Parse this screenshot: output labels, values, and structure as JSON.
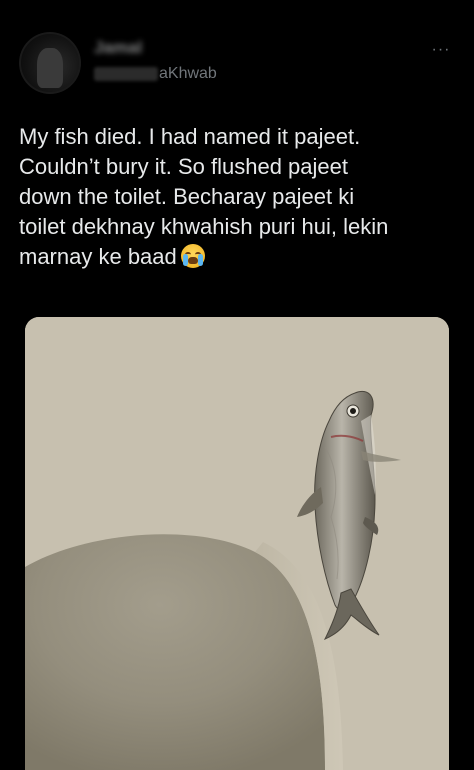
{
  "header": {
    "display_name": "Jamal",
    "handle": "aKhwab",
    "more_label": "···"
  },
  "tweet": {
    "lines": [
      "My fish died. I had named it pajeet.",
      "Couldn’t bury it. So flushed pajeet",
      "down the toilet. Becharay pajeet ki",
      "toilet dekhnay khwahish puri hui, lekin",
      "marnay ke baad"
    ],
    "emoji": "loudly-crying-face-icon"
  },
  "media": {
    "alt": ""
  },
  "colors": {
    "background": "#000000",
    "text": "#e7e9ea",
    "secondary": "#71767b",
    "wall": "#c6bfad"
  }
}
